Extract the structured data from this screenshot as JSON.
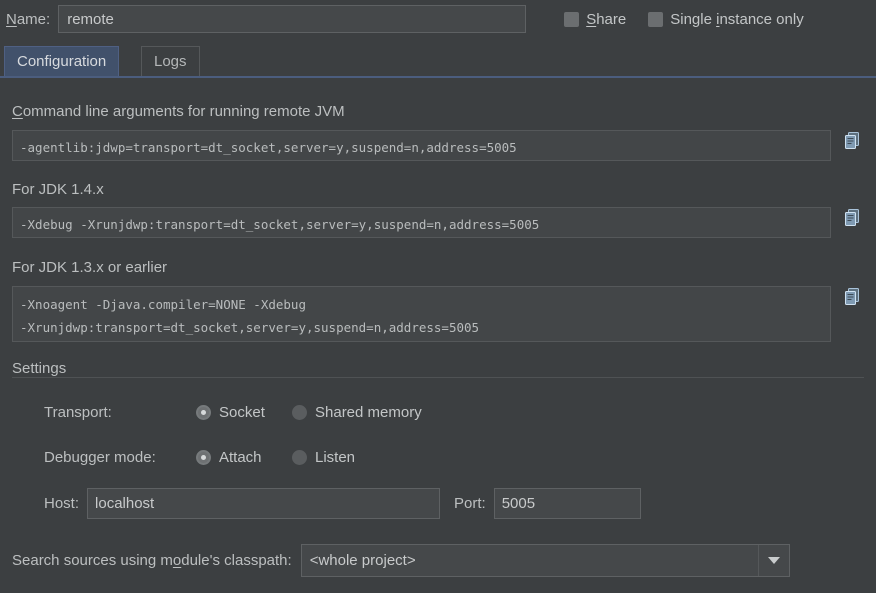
{
  "name_row": {
    "label": "Name:",
    "label_mnemonic": "N",
    "value": "remote",
    "placeholder": "",
    "checkboxes": [
      {
        "label_pre": "",
        "label_mnemonic": "S",
        "label_post": "hare",
        "full": "Share",
        "checked": false
      },
      {
        "label_pre": "Single ",
        "label_mnemonic": "i",
        "label_post": "nstance only",
        "full": "Single instance only",
        "checked": false
      }
    ]
  },
  "tabs": [
    {
      "label": "Configuration",
      "selected": true
    },
    {
      "label": "Logs",
      "selected": false
    }
  ],
  "sections": [
    {
      "title_pre": "",
      "title_mnemonic": "C",
      "title_post": "ommand line arguments for running remote JVM",
      "title": "Command line arguments for running remote JVM",
      "value": "-agentlib:jdwp=transport=dt_socket,server=y,suspend=n,address=5005",
      "copy_icon": "copy-icon"
    },
    {
      "title_pre": "For JDK 1.4.x",
      "title_mnemonic": "",
      "title_post": "",
      "title": "For JDK 1.4.x",
      "value": "-Xdebug -Xrunjdwp:transport=dt_socket,server=y,suspend=n,address=5005",
      "copy_icon": "copy-icon"
    },
    {
      "title_pre": "For JDK 1.3.x or earlier",
      "title_mnemonic": "",
      "title_post": "",
      "title": "For JDK 1.3.x or earlier",
      "value": "-Xnoagent -Djava.compiler=NONE -Xdebug\n-Xrunjdwp:transport=dt_socket,server=y,suspend=n,address=5005",
      "copy_icon": "copy-icon"
    }
  ],
  "settings": {
    "title": "Settings",
    "transport": {
      "label": "Transport:",
      "options": [
        {
          "label": "Socket",
          "selected": true
        },
        {
          "label": "Shared memory",
          "selected": false
        }
      ]
    },
    "debugger_mode": {
      "label": "Debugger mode:",
      "options": [
        {
          "label": "Attach",
          "selected": true
        },
        {
          "label": "Listen",
          "selected": false
        }
      ]
    },
    "host": {
      "label": "Host:",
      "value": "localhost",
      "placeholder": ""
    },
    "port": {
      "label": "Port:",
      "value": "5005",
      "placeholder": ""
    }
  },
  "classpath": {
    "label_pre": "Search sources using m",
    "label_mnemonic": "o",
    "label_post": "dule's classpath:",
    "label": "Search sources using module's classpath:",
    "value": "<whole project>",
    "arrow_icon": "chevron-down-icon"
  },
  "colors": {
    "background": "#3c3f41",
    "field_background": "#45484a",
    "readonly_background": "#434648",
    "tab_selected": "#41516b",
    "tab_underline": "#4b5d7e",
    "text": "#bcbfc0",
    "copy_icon": "#9bb4cc"
  }
}
